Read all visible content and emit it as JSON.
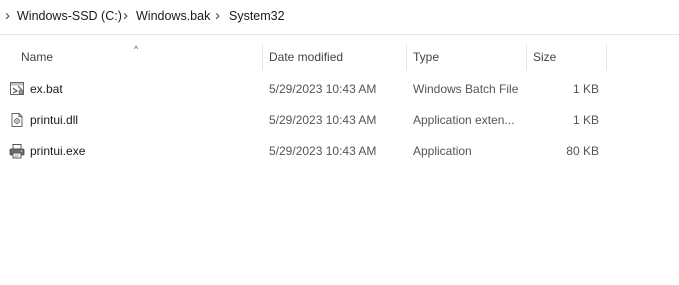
{
  "breadcrumb": {
    "items": [
      "Windows-SSD (C:)",
      "Windows.bak",
      "System32"
    ]
  },
  "columns": {
    "name": "Name",
    "date": "Date modified",
    "type": "Type",
    "size": "Size"
  },
  "files": [
    {
      "name": "ex.bat",
      "date": "5/29/2023 10:43 AM",
      "type": "Windows Batch File",
      "size": "1 KB",
      "icon": "batch-file-icon"
    },
    {
      "name": "printui.dll",
      "date": "5/29/2023 10:43 AM",
      "type": "Application exten...",
      "size": "1 KB",
      "icon": "dll-file-icon"
    },
    {
      "name": "printui.exe",
      "date": "5/29/2023 10:43 AM",
      "type": "Application",
      "size": "80 KB",
      "icon": "printer-app-icon"
    }
  ]
}
